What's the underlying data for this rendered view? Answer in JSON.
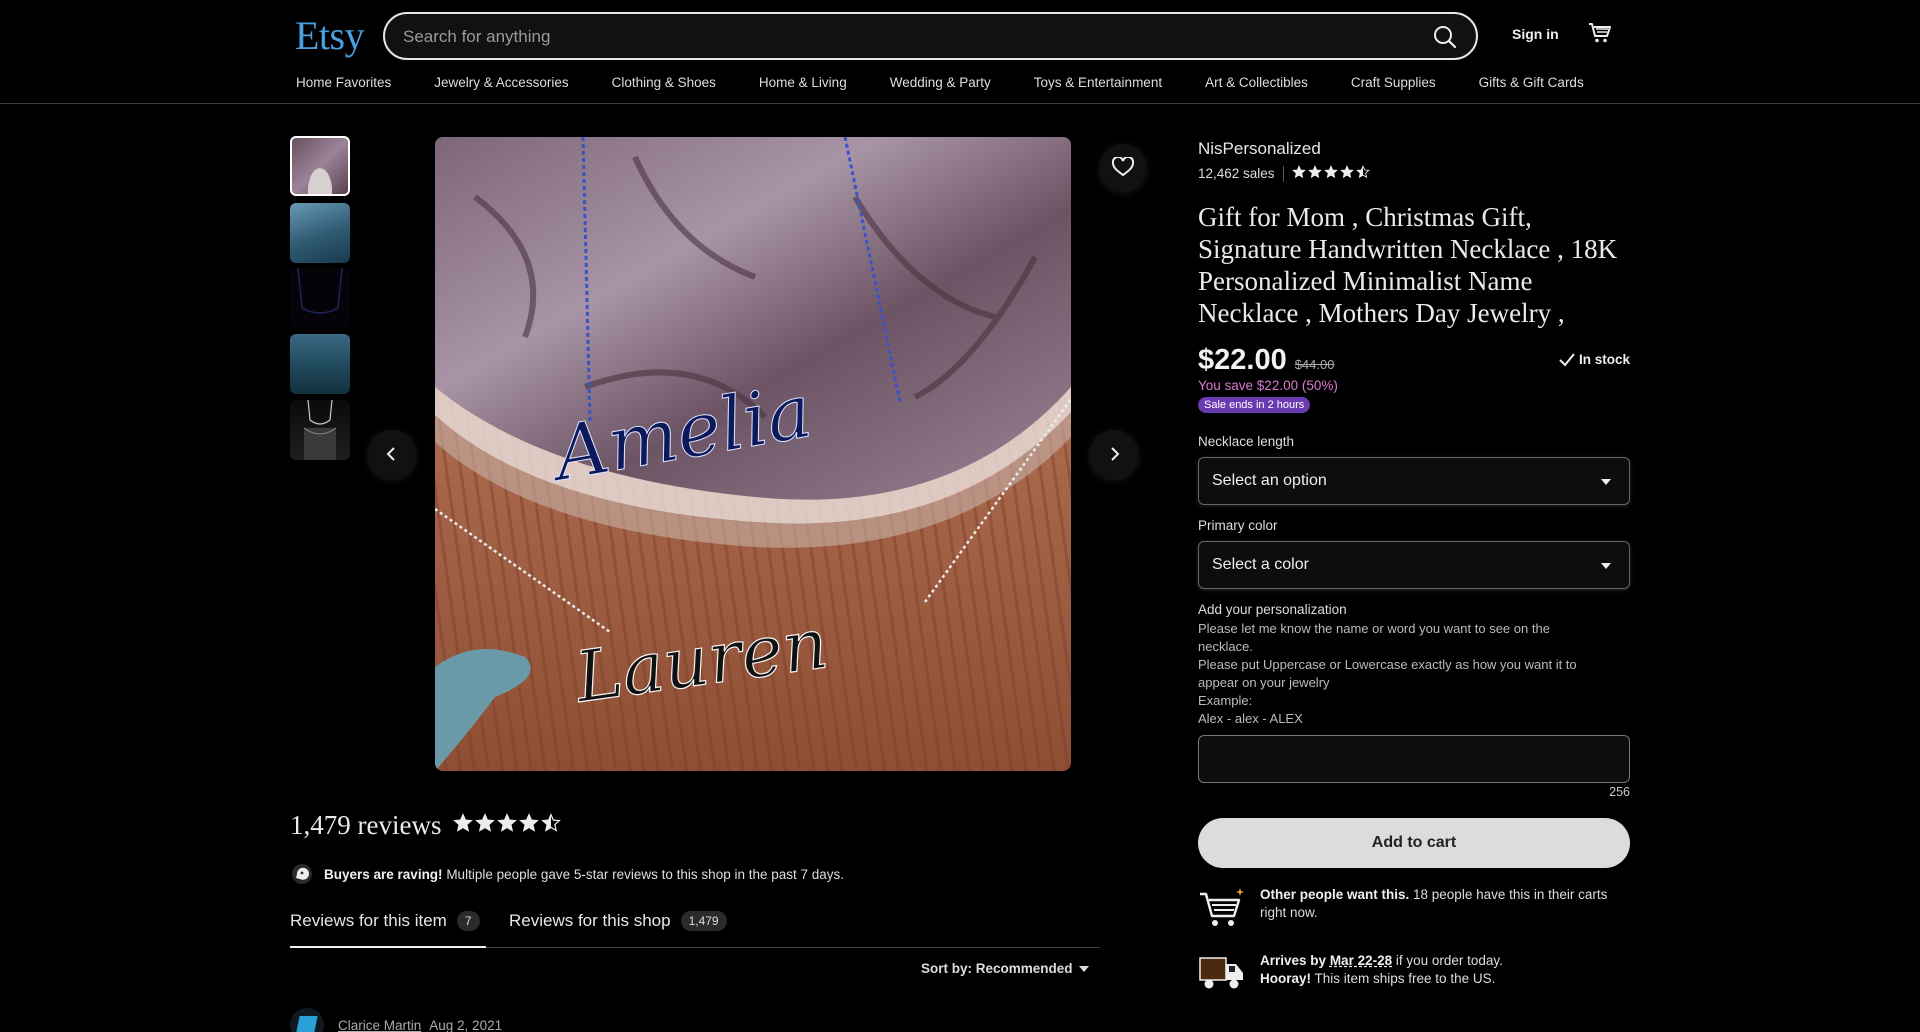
{
  "header": {
    "logo": "Etsy",
    "search_placeholder": "Search for anything",
    "sign_in": "Sign in"
  },
  "categories": [
    "Home Favorites",
    "Jewelry & Accessories",
    "Clothing & Shoes",
    "Home & Living",
    "Wedding & Party",
    "Toys & Entertainment",
    "Art & Collectibles",
    "Craft Supplies",
    "Gifts & Gift Cards"
  ],
  "gallery": {
    "image_names": [
      "Amelia",
      "Lauren"
    ]
  },
  "product": {
    "shop_name": "NisPersonalized",
    "sales": "12,462 sales",
    "shop_rating": 4.5,
    "title": "Gift for Mom , Christmas Gift, Signature Handwritten Necklace , 18K Personalized Minimalist Name Necklace , Mothers Day Jewelry ,",
    "price": "$22.00",
    "old_price": "$44.00",
    "stock": "In stock",
    "savings": "You save $22.00 (50%)",
    "sale_badge": "Sale ends in 2 hours",
    "length_label": "Necklace length",
    "length_value": "Select an option",
    "color_label": "Primary color",
    "color_value": "Select a color",
    "personalization_label": "Add your personalization",
    "personalization_lines": [
      "Please let me know the name or word you want to see on the",
      "necklace.",
      "Please put Uppercase or Lowercase exactly as how you want it to",
      "appear on your jewelry",
      "Example:",
      "Alex - alex - ALEX"
    ],
    "char_count": "256",
    "add_to_cart": "Add to cart",
    "demand_bold": "Other people want this.",
    "demand_text": " 18 people have this in their carts right now.",
    "arrives_bold": "Arrives by",
    "arrives_date": "Mar 22-28",
    "arrives_text": " if you order today.",
    "hooray_bold": "Hooray!",
    "hooray_text": " This item ships free to the US."
  },
  "reviews": {
    "count_label": "1,479 reviews",
    "rating": 4.5,
    "raving_bold": "Buyers are raving!",
    "raving_text": " Multiple people gave 5-star reviews to this shop in the past 7 days.",
    "tab_item_label": "Reviews for this item",
    "tab_item_count": "7",
    "tab_shop_label": "Reviews for this shop",
    "tab_shop_count": "1,479",
    "sort_label": "Sort by: Recommended",
    "first_reviewer": "Clarice Martin",
    "first_date": "Aug 2, 2021"
  },
  "colors": {
    "logo": "#4a9fe0",
    "savings": "#d67bd1",
    "sale_badge": "#6a3ab0",
    "add_to_cart_bg": "#dcdcdc"
  }
}
